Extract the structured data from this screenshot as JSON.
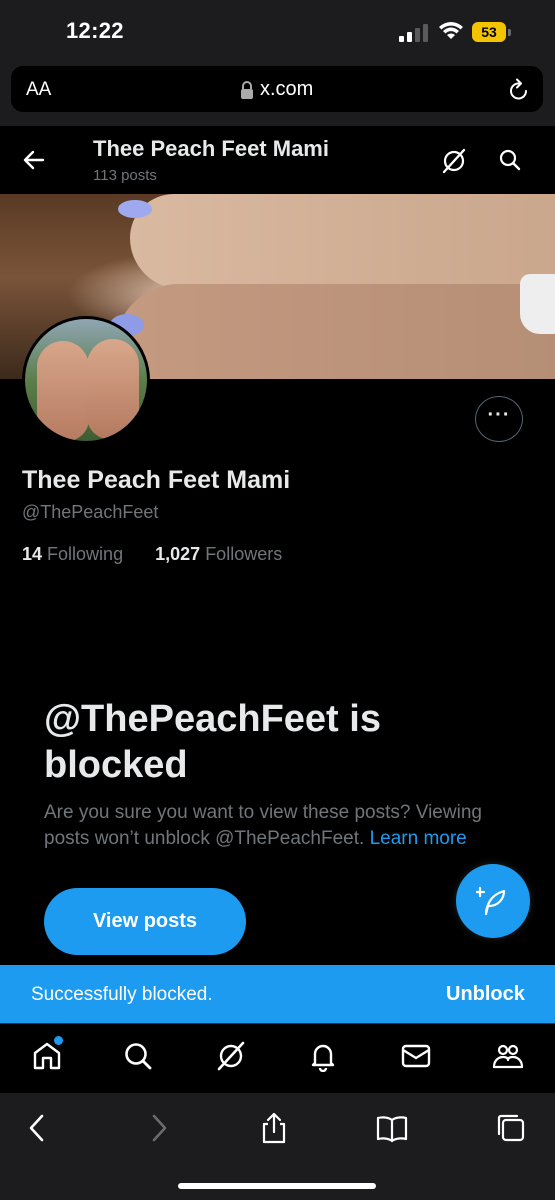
{
  "status_bar": {
    "time": "12:22",
    "battery": "53"
  },
  "browser": {
    "text_size_label": "AA",
    "url": "x.com"
  },
  "header": {
    "title": "Thee Peach Feet Mami",
    "posts_count": "113 posts"
  },
  "profile": {
    "display_name": "Thee Peach Feet Mami",
    "handle": "@ThePeachFeet",
    "following_count": "14",
    "following_label": "Following",
    "followers_count": "1,027",
    "followers_label": "Followers"
  },
  "blocked": {
    "title": "@ThePeachFeet is blocked",
    "description": "Are you sure you want to view these posts? Viewing posts won’t unblock @ThePeachFeet.",
    "learn_more": "Learn more",
    "view_posts_label": "View posts"
  },
  "toast": {
    "message": "Successfully blocked.",
    "action": "Unblock"
  },
  "nav": {
    "items": [
      "home-icon",
      "search-icon",
      "grok-icon",
      "notifications-icon",
      "messages-icon",
      "communities-icon"
    ],
    "active": "home"
  },
  "toolbar": {
    "items": [
      "back-arrow-icon",
      "forward-arrow-icon",
      "share-icon",
      "bookmarks-icon",
      "tabs-icon"
    ]
  },
  "colors": {
    "accent": "#1d9bf0",
    "background": "#000000",
    "muted": "#71767b"
  }
}
